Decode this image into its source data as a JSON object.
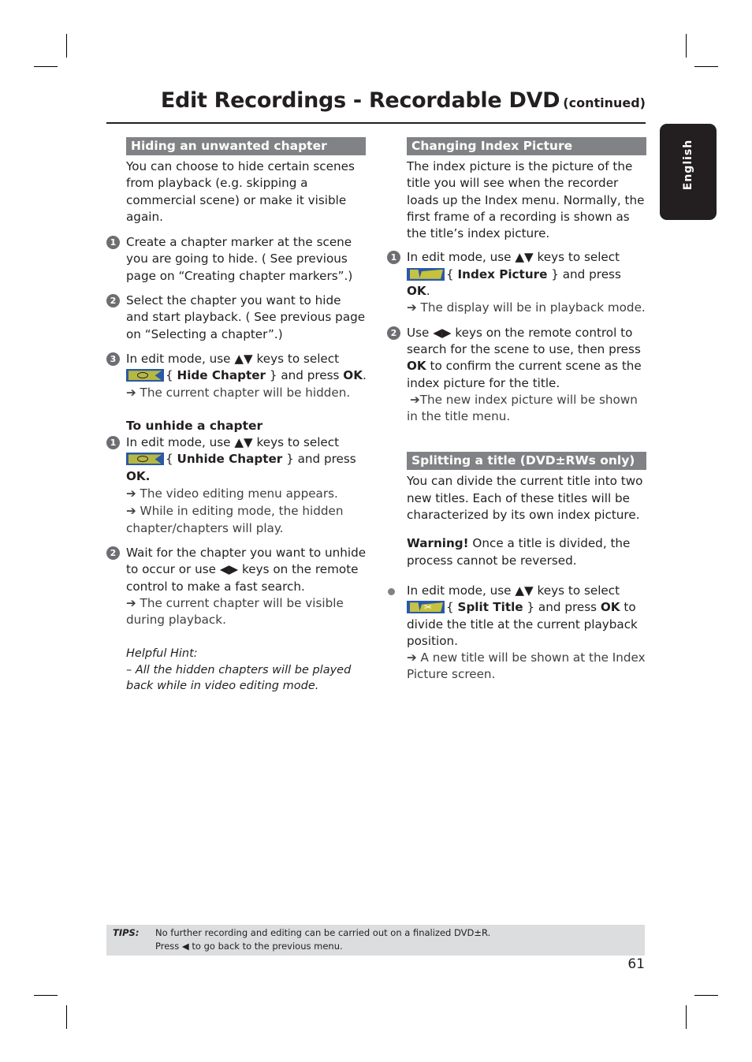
{
  "header": {
    "title": "Edit Recordings - Recordable DVD",
    "continued": "(continued)"
  },
  "language_tab": "English",
  "left_column": {
    "section_title": "Hiding an unwanted chapter",
    "intro": "You can choose to hide certain scenes from playback (e.g. skipping a commercial scene) or make it visible again.",
    "steps": [
      {
        "num": "1",
        "text": "Create a chapter marker at the scene you are going to hide. ( See previous page on “Creating chapter markers”.)"
      },
      {
        "num": "2",
        "text": "Select the chapter you want to hide and start playback. ( See previous page on “Selecting a chapter”.)"
      },
      {
        "num": "3",
        "pre": "In edit mode, use ▲▼ keys to select",
        "icon": "hide-chapter-icon",
        "brace_open": "{ ",
        "option": "Hide Chapter",
        "brace_close": " } and press ",
        "ok": "OK",
        "post": ".",
        "result": "➔ The current chapter will be hidden."
      }
    ],
    "unhide_title": "To unhide a chapter",
    "unhide_steps": [
      {
        "num": "1",
        "pre": "In edit mode, use ▲▼ keys to select",
        "icon": "unhide-chapter-icon",
        "brace_open": "{ ",
        "option": "Unhide Chapter",
        "brace_close": " } and press",
        "ok": "OK.",
        "result1": "➔ The video editing menu appears.",
        "result2": "➔ While in editing mode, the hidden chapter/chapters will play."
      },
      {
        "num": "2",
        "text": "Wait for the chapter you want to unhide to occur or use ◀▶ keys on the remote control to make a fast search.",
        "result": "➔ The current chapter will be visible during playback."
      }
    ],
    "hint_title": "Helpful Hint:",
    "hint_text": "– All the hidden chapters will be played back while in video editing mode."
  },
  "right_column": {
    "section1_title": "Changing Index Picture",
    "section1_intro": "The index picture is the picture of the title you will see when the recorder loads up the Index menu. Normally, the first frame of a recording is shown as the title’s index picture.",
    "section1_steps": [
      {
        "num": "1",
        "pre": "In edit mode, use ▲▼ keys to select",
        "icon": "index-picture-icon",
        "brace_open": "{ ",
        "option": "Index Picture",
        "brace_close": " } and press ",
        "ok": "OK",
        "post": ".",
        "result": "➔ The display will be in playback mode."
      },
      {
        "num": "2",
        "pre": "Use ◀▶ keys on the remote control to search for the scene to use, then press ",
        "ok": "OK",
        "post": " to confirm the current scene as the index picture for the title.",
        "result": "➔The new index picture will be shown in the title menu."
      }
    ],
    "section2_title": "Splitting a title (DVD±RWs only)",
    "section2_intro": "You can divide the current title into two new titles. Each of these titles will be characterized by its own index picture.",
    "warning_label": "Warning!",
    "warning_text": " Once a title is divided, the process cannot be reversed.",
    "section2_step": {
      "pre": "In edit mode, use ▲▼ keys to select",
      "icon": "split-title-icon",
      "brace_open": "{ ",
      "option": "Split Title",
      "brace_close": " } and press ",
      "ok": "OK",
      "post": " to divide the title at the current playback position.",
      "result": "➔ A new title will be shown at the Index Picture screen."
    }
  },
  "tips": {
    "label": "TIPS:",
    "line1": "No further recording and editing can be carried out on a finalized DVD±R.",
    "line2": "Press ◀ to go back to the previous menu."
  },
  "page_number": "61"
}
